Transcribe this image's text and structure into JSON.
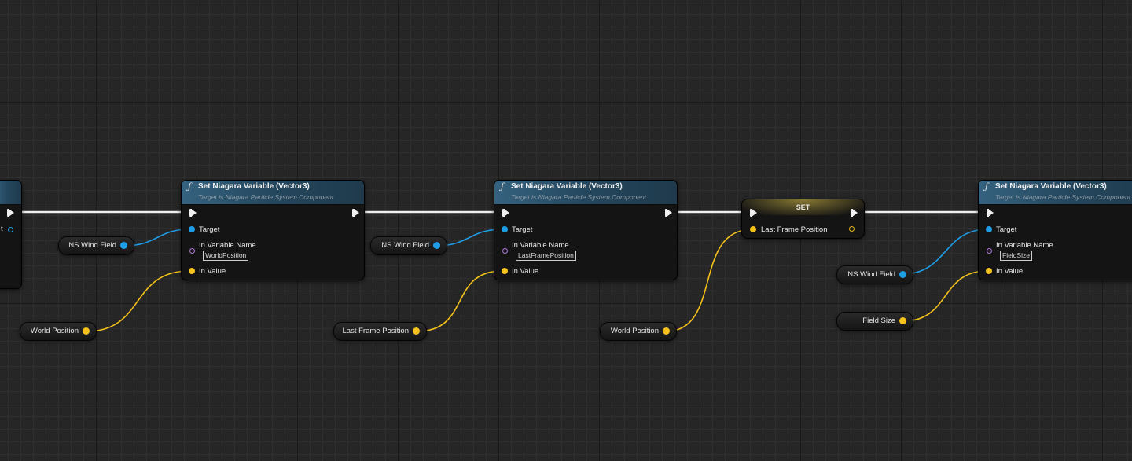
{
  "graph": {
    "colors": {
      "exec_wire": "#f0f0f0",
      "object_wire": "#1e9de8",
      "vector_wire": "#f5c11b",
      "name_pin": "#b07ad8",
      "node_header": "#35627f"
    },
    "nodes": [
      {
        "title": "Set Niagara Variable (Vector3)",
        "subtitle": "Target is Niagara Particle System Component",
        "pins": {
          "target": "Target",
          "variable_name_label": "In Variable Name",
          "variable_name_value": "WorldPosition",
          "value": "In Value"
        }
      },
      {
        "title": "Set Niagara Variable (Vector3)",
        "subtitle": "Target is Niagara Particle System Component",
        "pins": {
          "target": "Target",
          "variable_name_label": "In Variable Name",
          "variable_name_value": "LastFramePosition",
          "value": "In Value"
        }
      },
      {
        "title": "Set Niagara Variable (Vector3)",
        "subtitle": "Target is Niagara Particle System Component",
        "pins": {
          "target": "Target",
          "variable_name_label": "In Variable Name",
          "variable_name_value": "FieldSize",
          "value": "In Value"
        }
      }
    ],
    "set_node": {
      "title": "SET",
      "pin_label": "Last Frame Position"
    },
    "getters": [
      {
        "label": "NS Wind Field",
        "type": "object"
      },
      {
        "label": "World Position",
        "type": "vector"
      },
      {
        "label": "NS Wind Field",
        "type": "object"
      },
      {
        "label": "Last Frame Position",
        "type": "vector"
      },
      {
        "label": "World Position",
        "type": "vector"
      },
      {
        "label": "NS Wind Field",
        "type": "object"
      },
      {
        "label": "Field Size",
        "type": "vector"
      }
    ],
    "partial_left_node": {
      "pin_fragment": "t"
    }
  }
}
